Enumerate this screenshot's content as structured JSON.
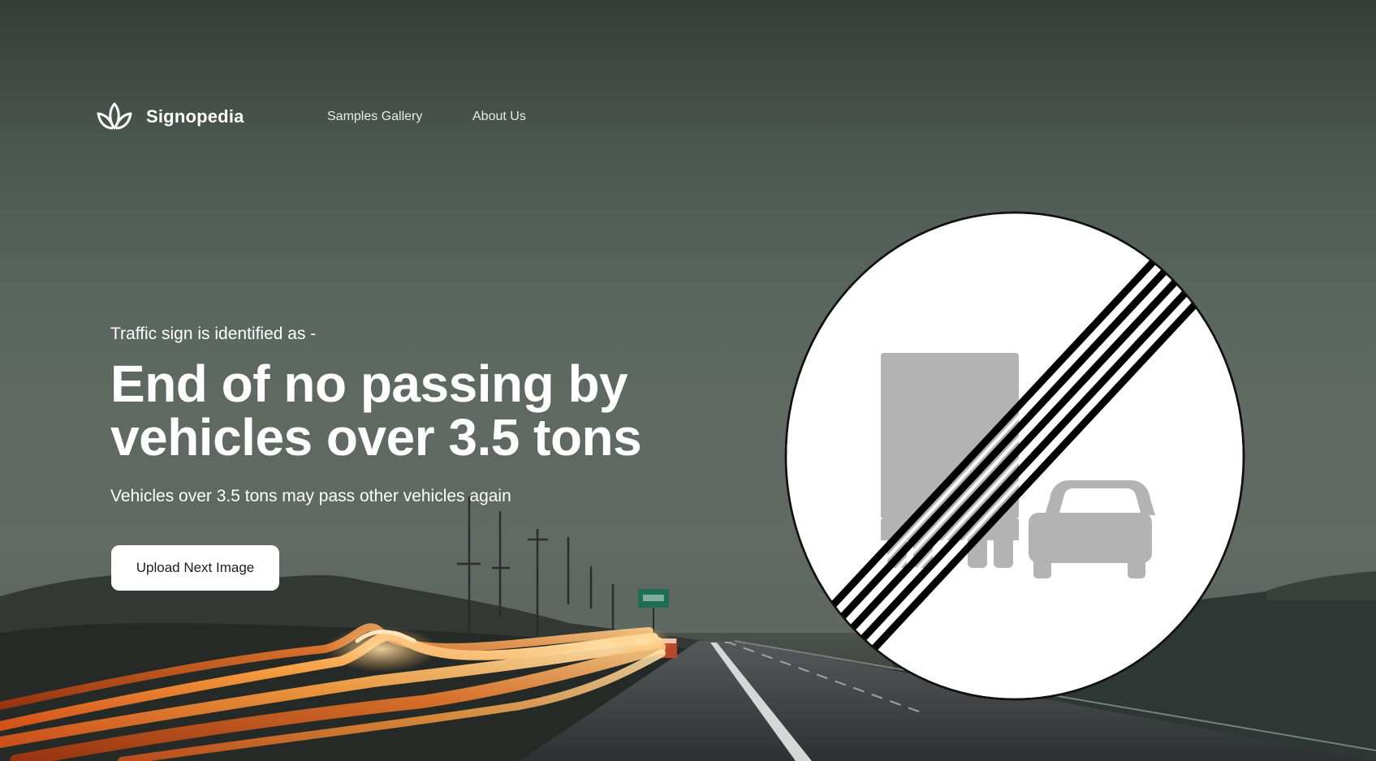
{
  "brand": {
    "name": "Signopedia",
    "logo_icon": "lotus-icon"
  },
  "nav": {
    "items": [
      {
        "label": "Samples Gallery"
      },
      {
        "label": "About Us"
      }
    ]
  },
  "hero": {
    "eyebrow": "Traffic sign is identified as -",
    "title": "End of no passing by vehicles over 3.5 tons",
    "description": "Vehicles over 3.5 tons may pass other vehicles again",
    "button_label": "Upload Next Image"
  },
  "sign": {
    "icon": "end-of-no-passing-trucks-sign-icon",
    "face_color": "#ffffff",
    "symbol_color": "#b3b3b3",
    "stripe_color": "#000000"
  },
  "background": {
    "description_icon": "highway-light-trails-image"
  }
}
